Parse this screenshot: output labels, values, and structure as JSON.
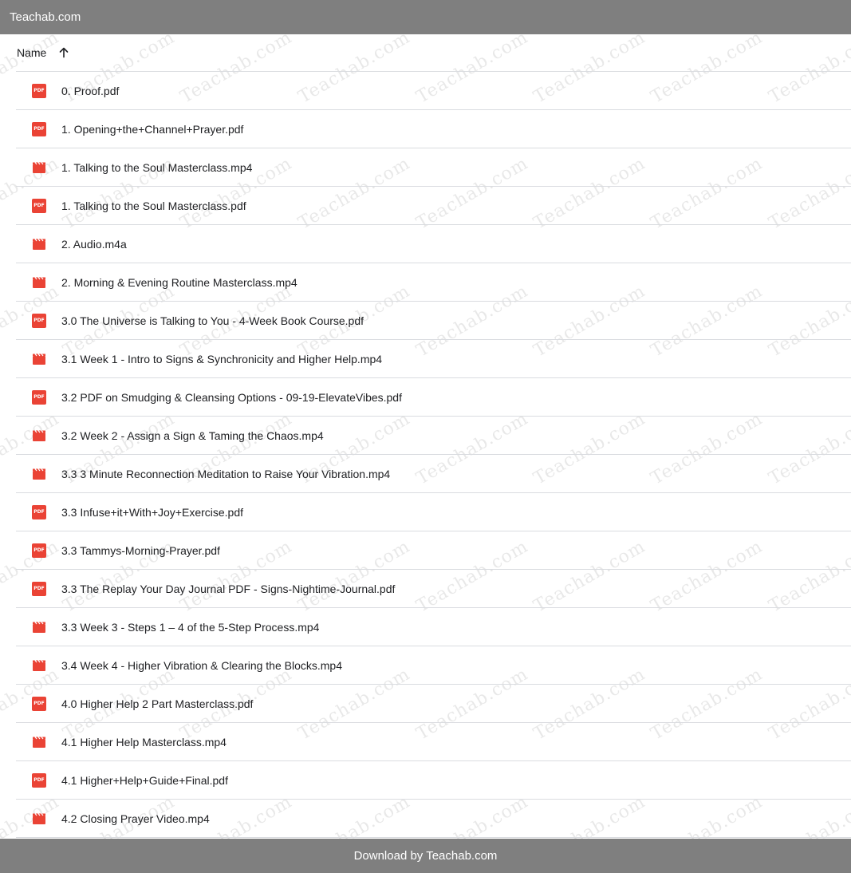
{
  "site_title": "Teachab.com",
  "watermark_text": "Teachab.com",
  "header": {
    "name_label": "Name",
    "sort_icon": "arrow-up-icon"
  },
  "files": [
    {
      "name": "0. Proof.pdf",
      "type": "pdf"
    },
    {
      "name": "1. Opening+the+Channel+Prayer.pdf",
      "type": "pdf"
    },
    {
      "name": "1. Talking to the Soul Masterclass.mp4",
      "type": "video"
    },
    {
      "name": "1. Talking to the Soul Masterclass.pdf",
      "type": "pdf"
    },
    {
      "name": "2. Audio.m4a",
      "type": "video"
    },
    {
      "name": "2. Morning & Evening Routine Masterclass.mp4",
      "type": "video"
    },
    {
      "name": "3.0 The Universe is Talking to You - 4-Week Book Course.pdf",
      "type": "pdf"
    },
    {
      "name": "3.1 Week 1 - Intro to Signs & Synchronicity and Higher Help.mp4",
      "type": "video"
    },
    {
      "name": "3.2 PDF on Smudging & Cleansing Options - 09-19-ElevateVibes.pdf",
      "type": "pdf"
    },
    {
      "name": "3.2 Week 2 - Assign a Sign & Taming the Chaos.mp4",
      "type": "video"
    },
    {
      "name": "3.3 3 Minute Reconnection Meditation to Raise Your Vibration.mp4",
      "type": "video"
    },
    {
      "name": "3.3 Infuse+it+With+Joy+Exercise.pdf",
      "type": "pdf"
    },
    {
      "name": "3.3 Tammys-Morning-Prayer.pdf",
      "type": "pdf"
    },
    {
      "name": "3.3 The Replay Your Day Journal PDF - Signs-Nightime-Journal.pdf",
      "type": "pdf"
    },
    {
      "name": "3.3 Week 3 - Steps 1 – 4 of the 5-Step Process.mp4",
      "type": "video"
    },
    {
      "name": "3.4 Week 4 - Higher Vibration & Clearing the Blocks.mp4",
      "type": "video"
    },
    {
      "name": "4.0 Higher Help 2 Part Masterclass.pdf",
      "type": "pdf"
    },
    {
      "name": "4.1 Higher Help Masterclass.mp4",
      "type": "video"
    },
    {
      "name": "4.1 Higher+Help+Guide+Final.pdf",
      "type": "pdf"
    },
    {
      "name": "4.2 Closing Prayer Video.mp4",
      "type": "video"
    }
  ],
  "pdf_badge": "PDF",
  "colors": {
    "bar": "#7f7f7f",
    "pdf_icon": "#ea4335",
    "divider": "#dadce0"
  },
  "footer_text": "Download by Teachab.com"
}
